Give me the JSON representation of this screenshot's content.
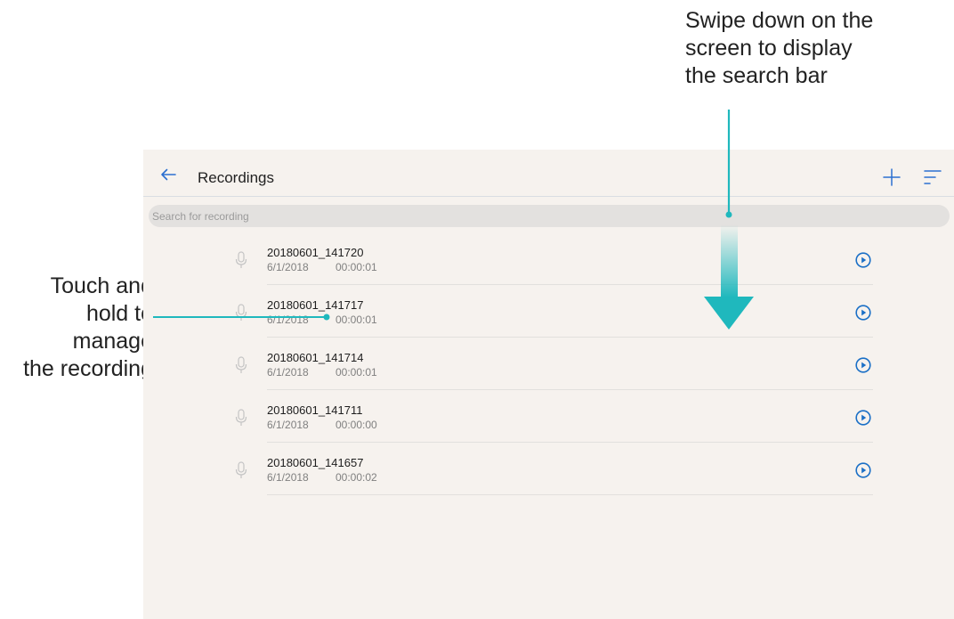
{
  "annotations": {
    "swipe": {
      "lines": [
        "Swipe down on the",
        "screen to display",
        "the search bar"
      ]
    },
    "hold": {
      "lines": [
        "Touch and",
        "hold to",
        "manage",
        "the recording"
      ]
    }
  },
  "app": {
    "title": "Recordings",
    "search": {
      "placeholder": "Search for recording"
    }
  },
  "recordings": [
    {
      "name": "20180601_141720",
      "date": "6/1/2018",
      "duration": "00:00:01"
    },
    {
      "name": "20180601_141717",
      "date": "6/1/2018",
      "duration": "00:00:01"
    },
    {
      "name": "20180601_141714",
      "date": "6/1/2018",
      "duration": "00:00:01"
    },
    {
      "name": "20180601_141711",
      "date": "6/1/2018",
      "duration": "00:00:00"
    },
    {
      "name": "20180601_141657",
      "date": "6/1/2018",
      "duration": "00:00:02"
    }
  ],
  "icons": {
    "back": "arrow-left-icon",
    "add": "plus-icon",
    "sort": "sort-icon",
    "mic": "microphone-icon",
    "play": "play-circle-icon",
    "swipe_arrow": "arrow-down-icon"
  },
  "colors": {
    "accent": "#1fb8bd",
    "screen_background": "#f6f2ee",
    "play_icon": "#1a6fc6"
  }
}
